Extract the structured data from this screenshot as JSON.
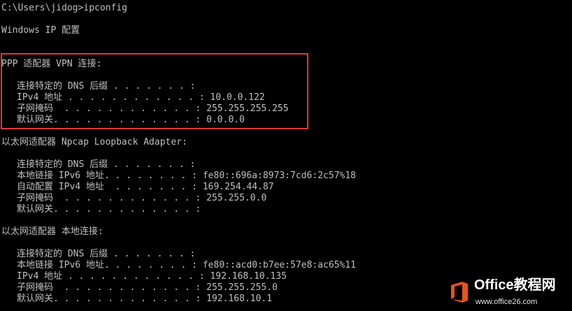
{
  "console": {
    "prompt": "C:\\Users\\jidog>ipconfig",
    "header": "Windows IP 配置",
    "adapters": [
      {
        "title": "PPP 适配器 VPN 连接:",
        "rows": [
          {
            "label": "连接特定的 DNS 后缀",
            "dots": " . . . . . . . :",
            "value": ""
          },
          {
            "label": "IPv4 地址",
            "dots": " . . . . . . . . . . . . :",
            "value": "10.0.0.122"
          },
          {
            "label": "子网掩码",
            "dots": "  . . . . . . . . . . . . :",
            "value": "255.255.255.255"
          },
          {
            "label": "默认网关.",
            "dots": " . . . . . . . . . . . . :",
            "value": "0.0.0.0"
          }
        ]
      },
      {
        "title": "以太网适配器 Npcap Loopback Adapter:",
        "rows": [
          {
            "label": "连接特定的 DNS 后缀",
            "dots": " . . . . . . . :",
            "value": ""
          },
          {
            "label": "本地链接 IPv6 地址",
            "dots": ". . . . . . . . :",
            "value": "fe80::696a:8973:7cd6:2c57%18"
          },
          {
            "label": "自动配置 IPv4 地址",
            "dots": "  . . . . . . . :",
            "value": "169.254.44.87"
          },
          {
            "label": "子网掩码",
            "dots": "  . . . . . . . . . . . . :",
            "value": "255.255.0.0"
          },
          {
            "label": "默认网关.",
            "dots": " . . . . . . . . . . . . :",
            "value": ""
          }
        ]
      },
      {
        "title": "以太网适配器 本地连接:",
        "rows": [
          {
            "label": "连接特定的 DNS 后缀",
            "dots": " . . . . . . . :",
            "value": ""
          },
          {
            "label": "本地链接 IPv6 地址",
            "dots": ". . . . . . . . :",
            "value": "fe80::acd0:b7ee:57e8:ac65%11"
          },
          {
            "label": "IPv4 地址",
            "dots": " . . . . . . . . . . . . :",
            "value": "192.168.10.135"
          },
          {
            "label": "子网掩码",
            "dots": "  . . . . . . . . . . . . :",
            "value": "255.255.255.0"
          },
          {
            "label": "默认网关.",
            "dots": " . . . . . . . . . . . . :",
            "value": "192.168.10.1"
          }
        ]
      }
    ]
  },
  "watermark": {
    "title": "Office教程网",
    "url": "www.office26.com"
  },
  "colors": {
    "background": "#000000",
    "text": "#c0c0c0",
    "highlight": "#e0393a",
    "logo_orange": "#e9531d"
  },
  "icons": {
    "logo": "office-logo-icon"
  }
}
